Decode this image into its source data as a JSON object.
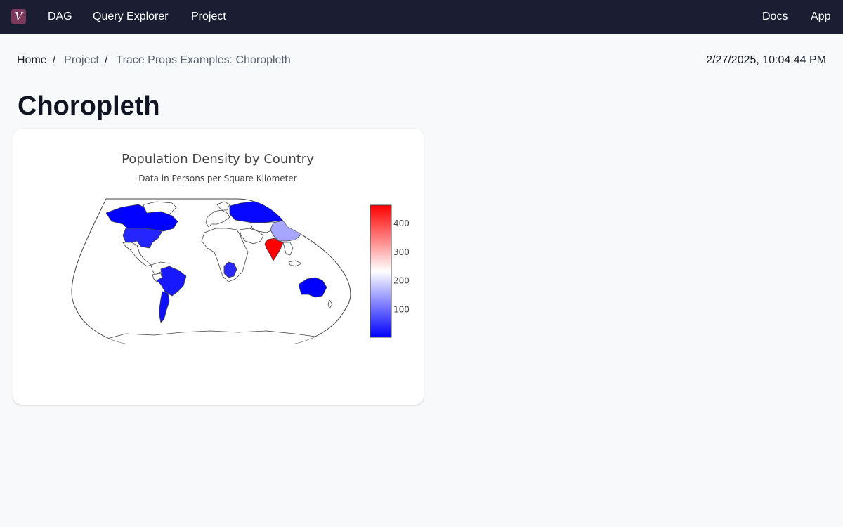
{
  "nav": {
    "logo_text": "V",
    "links": [
      "DAG",
      "Query Explorer",
      "Project"
    ],
    "right_links": [
      "Docs",
      "App"
    ]
  },
  "breadcrumb": {
    "items": [
      "Home",
      "Project",
      "Trace Props Examples: Choropleth"
    ],
    "separator": "/"
  },
  "timestamp": "2/27/2025, 10:04:44 PM",
  "page": {
    "title": "Choropleth"
  },
  "colors": {
    "nav_bg": "#1b1e33",
    "logo_bg": "#7b3a5c",
    "page_bg": "#f8f9fb",
    "scale_low": "#0000ff",
    "scale_mid": "#ffffff",
    "scale_high": "#ff0000"
  },
  "chart_data": {
    "type": "choropleth",
    "title": "Population Density by Country",
    "subtitle": "Data in Persons per Square Kilometer",
    "colorscale": [
      "#0000ff",
      "#ffffff",
      "#ff0000"
    ],
    "zmin": 3,
    "zmax": 464,
    "colorbar_ticks": [
      100,
      200,
      300,
      400
    ],
    "locations": [
      {
        "country": "Canada",
        "value": 4
      },
      {
        "country": "United States",
        "value": 36
      },
      {
        "country": "Brazil",
        "value": 25
      },
      {
        "country": "Argentina",
        "value": 17
      },
      {
        "country": "Russia",
        "value": 9
      },
      {
        "country": "China",
        "value": 153
      },
      {
        "country": "India",
        "value": 464
      },
      {
        "country": "DR Congo",
        "value": 40
      },
      {
        "country": "Australia",
        "value": 3
      }
    ]
  }
}
